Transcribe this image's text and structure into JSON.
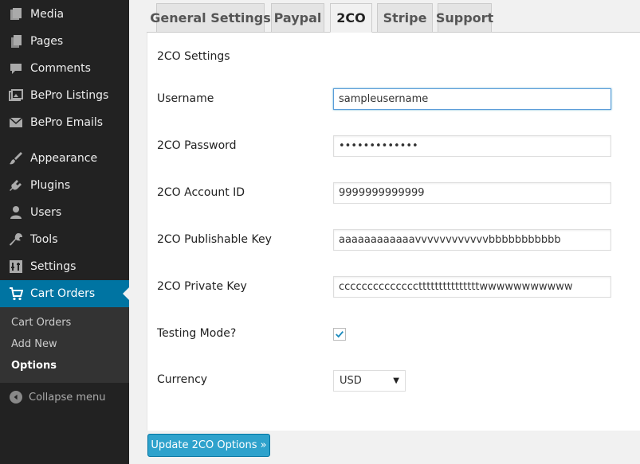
{
  "sidebar": {
    "items": [
      {
        "label": "Media",
        "icon": "media-icon"
      },
      {
        "label": "Pages",
        "icon": "pages-icon"
      },
      {
        "label": "Comments",
        "icon": "comments-icon"
      },
      {
        "label": "BePro Listings",
        "icon": "gallery-icon"
      },
      {
        "label": "BePro Emails",
        "icon": "email-icon"
      },
      {
        "label": "Appearance",
        "icon": "paintbrush-icon"
      },
      {
        "label": "Plugins",
        "icon": "plug-icon"
      },
      {
        "label": "Users",
        "icon": "user-icon"
      },
      {
        "label": "Tools",
        "icon": "wrench-icon"
      },
      {
        "label": "Settings",
        "icon": "sliders-icon"
      },
      {
        "label": "Cart Orders",
        "icon": "cart-icon"
      }
    ],
    "submenu": [
      {
        "label": "Cart Orders"
      },
      {
        "label": "Add New"
      },
      {
        "label": "Options"
      }
    ],
    "collapse_label": "Collapse menu"
  },
  "tabs": [
    {
      "label": "General Settings"
    },
    {
      "label": "Paypal"
    },
    {
      "label": "2CO"
    },
    {
      "label": "Stripe"
    },
    {
      "label": "Support"
    }
  ],
  "panel": {
    "title": "2CO Settings",
    "fields": {
      "username": {
        "label": "Username",
        "value": "sampleusername"
      },
      "password": {
        "label": "2CO Password",
        "value": "•••••••••••••"
      },
      "account_id": {
        "label": "2CO Account ID",
        "value": "9999999999999"
      },
      "publishable_key": {
        "label": "2CO Publishable Key",
        "value": "aaaaaaaaaaaavvvvvvvvvvvvbbbbbbbbbbb"
      },
      "private_key": {
        "label": "2CO Private Key",
        "value": "cccccccccccccctttttttttttttttwwwwwwwwwww"
      },
      "testing_mode": {
        "label": "Testing Mode?",
        "checked": true
      },
      "currency": {
        "label": "Currency",
        "value": "USD"
      }
    }
  },
  "submit_label": "Update 2CO Options »",
  "colors": {
    "sidebar": "#222222",
    "accent": "#0074a2",
    "button": "#2ea2cc"
  }
}
